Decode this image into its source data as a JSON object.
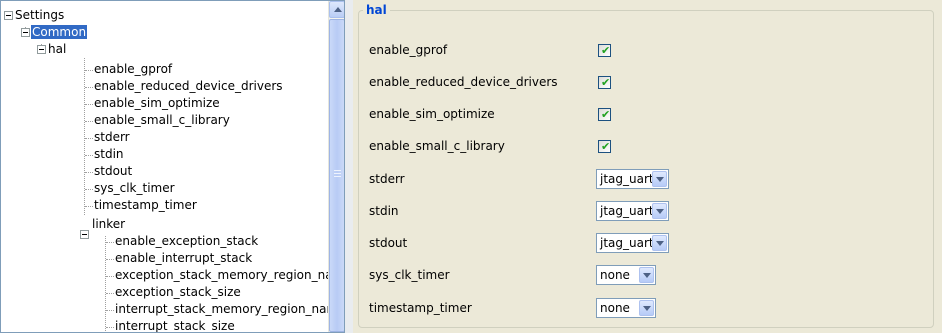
{
  "tree": {
    "nodes": [
      {
        "label": "Settings"
      },
      {
        "label": "Common"
      },
      {
        "label": "hal"
      },
      {
        "label": "enable_gprof"
      },
      {
        "label": "enable_reduced_device_drivers"
      },
      {
        "label": "enable_sim_optimize"
      },
      {
        "label": "enable_small_c_library"
      },
      {
        "label": "stderr"
      },
      {
        "label": "stdin"
      },
      {
        "label": "stdout"
      },
      {
        "label": "sys_clk_timer"
      },
      {
        "label": "timestamp_timer"
      },
      {
        "label": "linker"
      },
      {
        "label": "enable_exception_stack"
      },
      {
        "label": "enable_interrupt_stack"
      },
      {
        "label": "exception_stack_memory_region_na"
      },
      {
        "label": "exception_stack_size"
      },
      {
        "label": "interrupt_stack_memory_region_narr"
      },
      {
        "label": "interrupt_stack_size"
      }
    ],
    "selected": "Common"
  },
  "panel": {
    "group_title": "hal",
    "properties": [
      {
        "label": "enable_gprof",
        "type": "checkbox",
        "checked": true
      },
      {
        "label": "enable_reduced_device_drivers",
        "type": "checkbox",
        "checked": true
      },
      {
        "label": "enable_sim_optimize",
        "type": "checkbox",
        "checked": true
      },
      {
        "label": "enable_small_c_library",
        "type": "checkbox",
        "checked": true
      },
      {
        "label": "stderr",
        "type": "select",
        "value": "jtag_uart"
      },
      {
        "label": "stdin",
        "type": "select",
        "value": "jtag_uart"
      },
      {
        "label": "stdout",
        "type": "select",
        "value": "jtag_uart"
      },
      {
        "label": "sys_clk_timer",
        "type": "select",
        "value": "none"
      },
      {
        "label": "timestamp_timer",
        "type": "select",
        "value": "none"
      }
    ]
  },
  "icons": {
    "collapse": "minus-box-icon",
    "scroll_up": "scroll-up-arrow-icon",
    "dropdown": "dropdown-arrow-icon",
    "check": "checkmark-icon"
  },
  "colors": {
    "selection": "#316ac5",
    "group_title": "#0046d5",
    "panel_bg": "#ece9d8",
    "check": "#21a121"
  }
}
